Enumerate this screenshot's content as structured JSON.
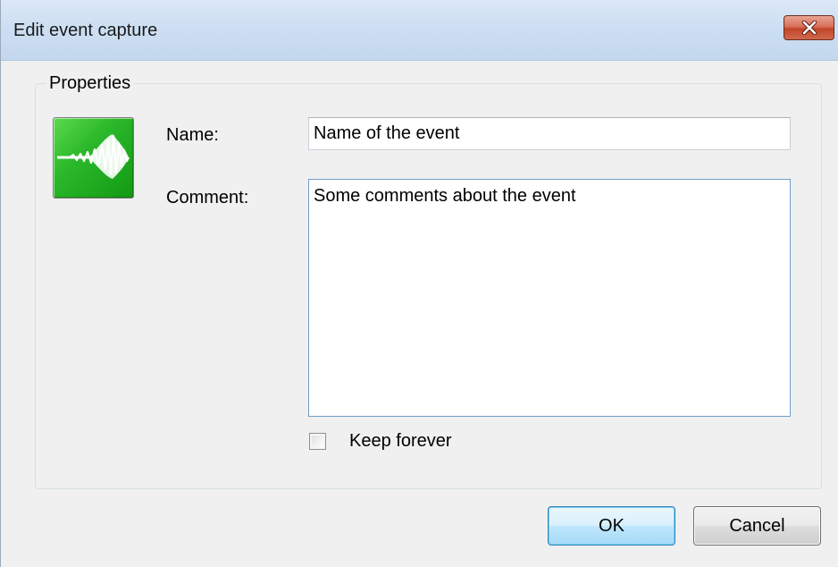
{
  "window": {
    "title": "Edit event capture",
    "close_icon": "close-icon"
  },
  "properties": {
    "legend": "Properties",
    "event_icon": "audio-waveform-icon",
    "name_label": "Name:",
    "name_value": "Name of the event",
    "comment_label": "Comment:",
    "comment_value": "Some comments about the event",
    "keep_forever_label": "Keep forever",
    "keep_forever_checked": false
  },
  "buttons": {
    "ok_label": "OK",
    "cancel_label": "Cancel"
  },
  "colors": {
    "titlebar": "#cddff2",
    "close_button": "#c24529",
    "icon_green": "#2bb82a",
    "ok_button_border": "#3c7fb1"
  }
}
